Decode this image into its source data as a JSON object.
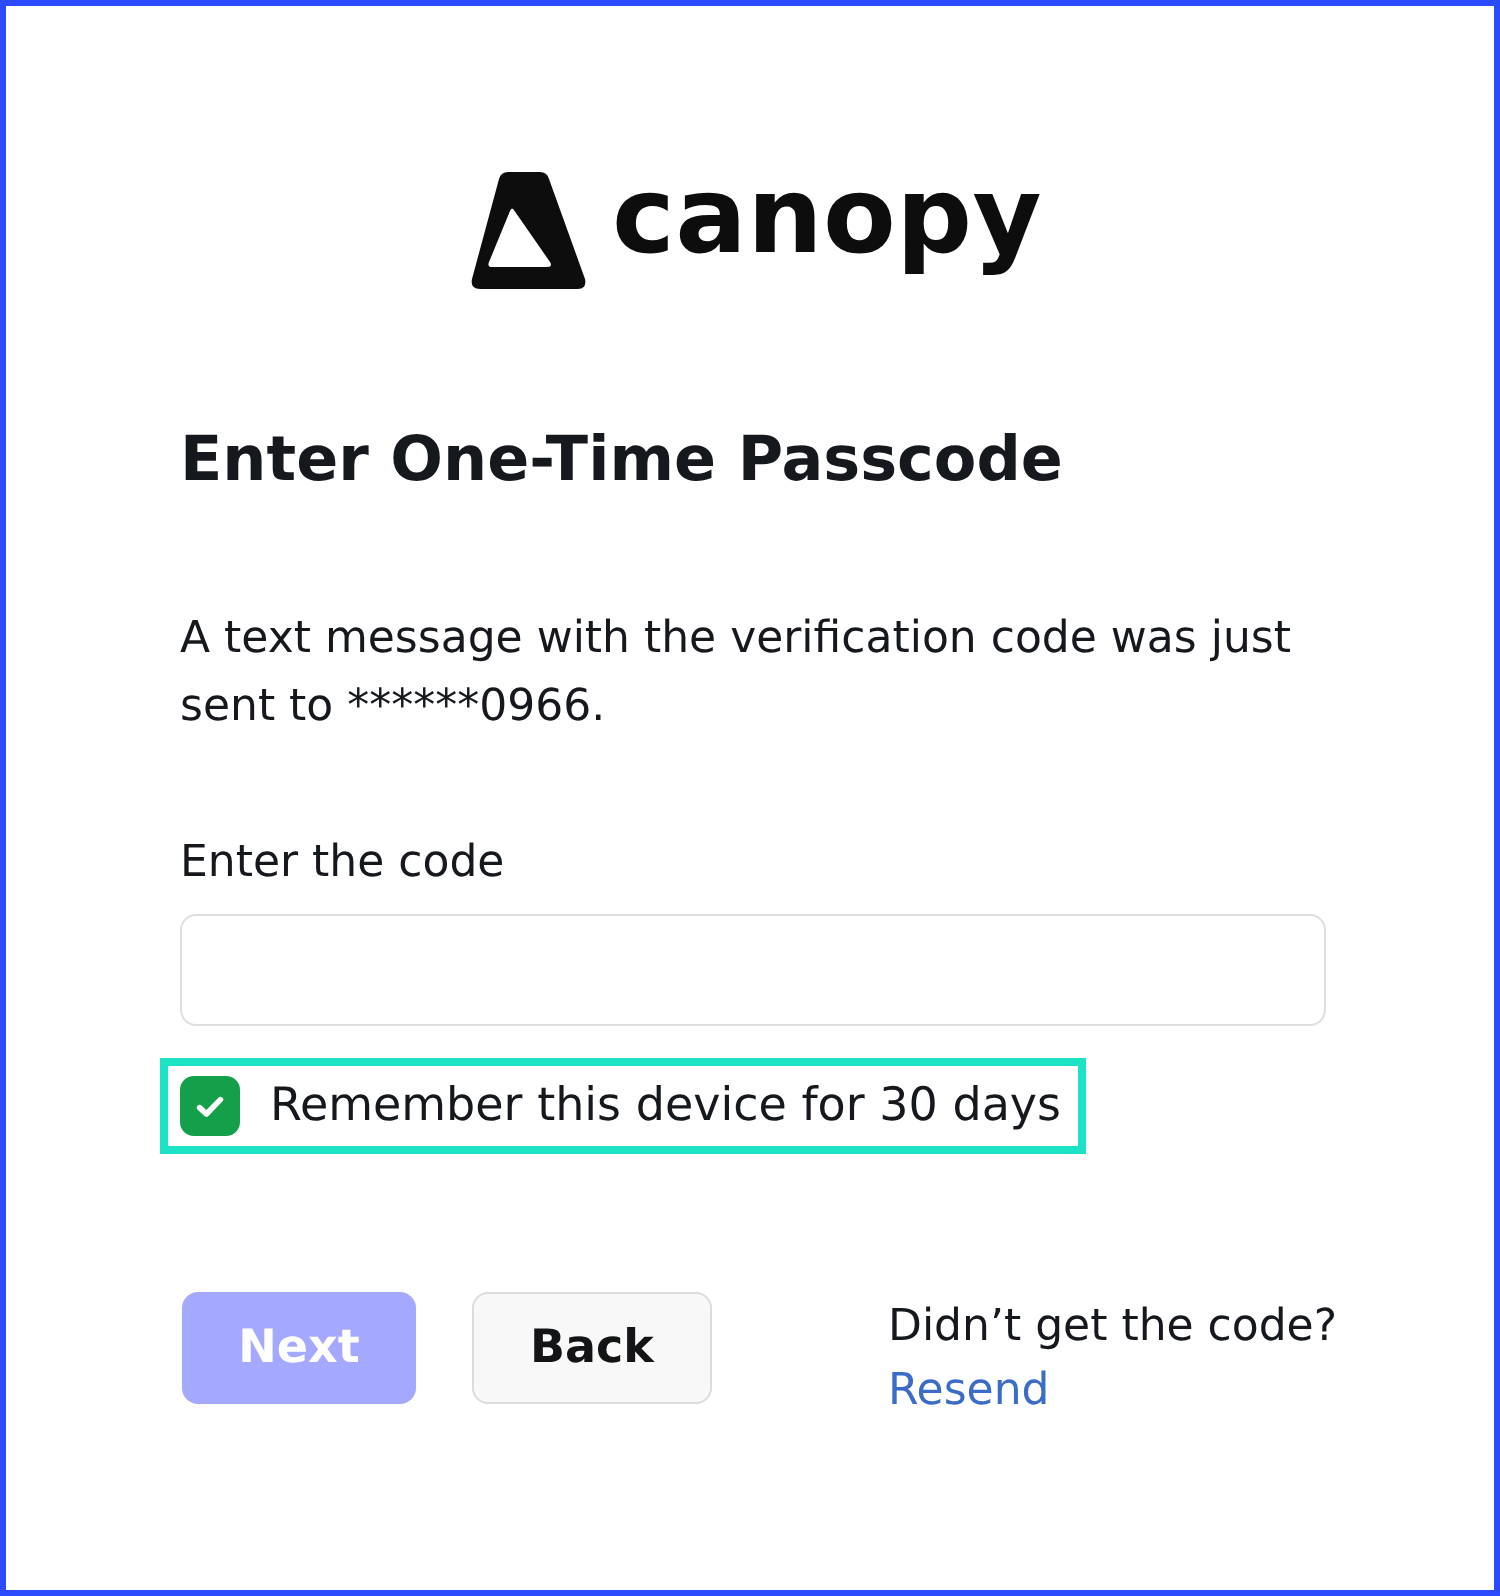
{
  "logo": {
    "wordmark": "canopy"
  },
  "title": "Enter One-Time Passcode",
  "message": "A text message with the verification code was just sent to ******0966.",
  "code_field": {
    "label": "Enter the code"
  },
  "remember": {
    "label": "Remember this device for 30 days",
    "checked": true,
    "highlighted": true
  },
  "buttons": [
    {
      "label": "Next",
      "kind": "primary",
      "disabled": true
    },
    {
      "label": "Back",
      "kind": "secondary",
      "disabled": false
    }
  ],
  "resend": {
    "prompt": "Didn’t get the code?",
    "link": "Resend"
  }
}
